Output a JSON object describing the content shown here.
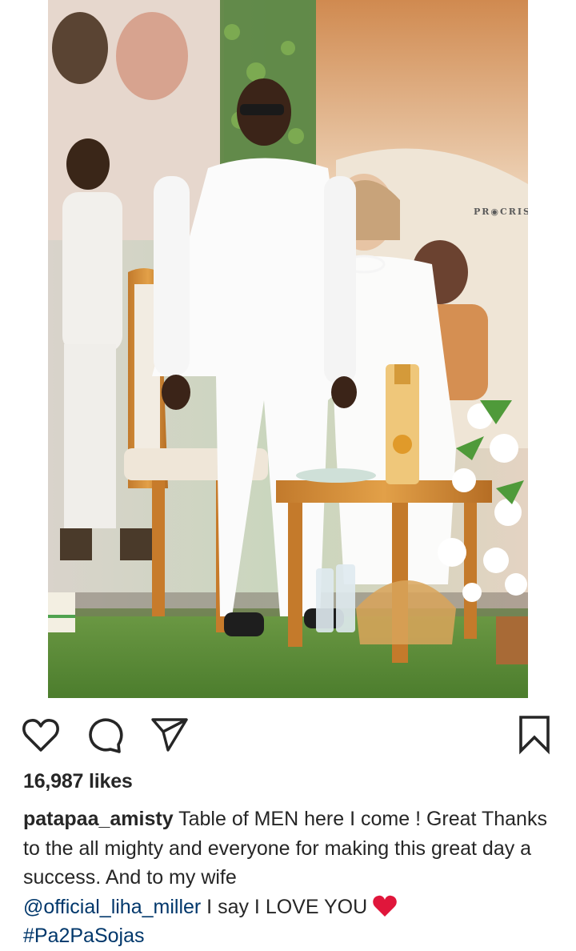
{
  "post": {
    "watermark": "PR◉CRIS",
    "likes_text": "16,987 likes",
    "caption": {
      "username": "patapaa_amisty",
      "text_1": " Table of MEN here I come ! Great Thanks to the all mighty and everyone for making this great day a success. And to my wife ",
      "mention": "@official_liha_miller",
      "text_2": " I say I LOVE YOU ",
      "hashtag": "#Pa2PaSojas"
    }
  },
  "icons": {
    "like": "heart-outline-icon",
    "comment": "comment-bubble-icon",
    "share": "paper-plane-icon",
    "save": "bookmark-icon",
    "emoji": "red-heart-emoji"
  },
  "colors": {
    "text": "#262626",
    "link": "#00376b",
    "heart": "#e0163b"
  }
}
